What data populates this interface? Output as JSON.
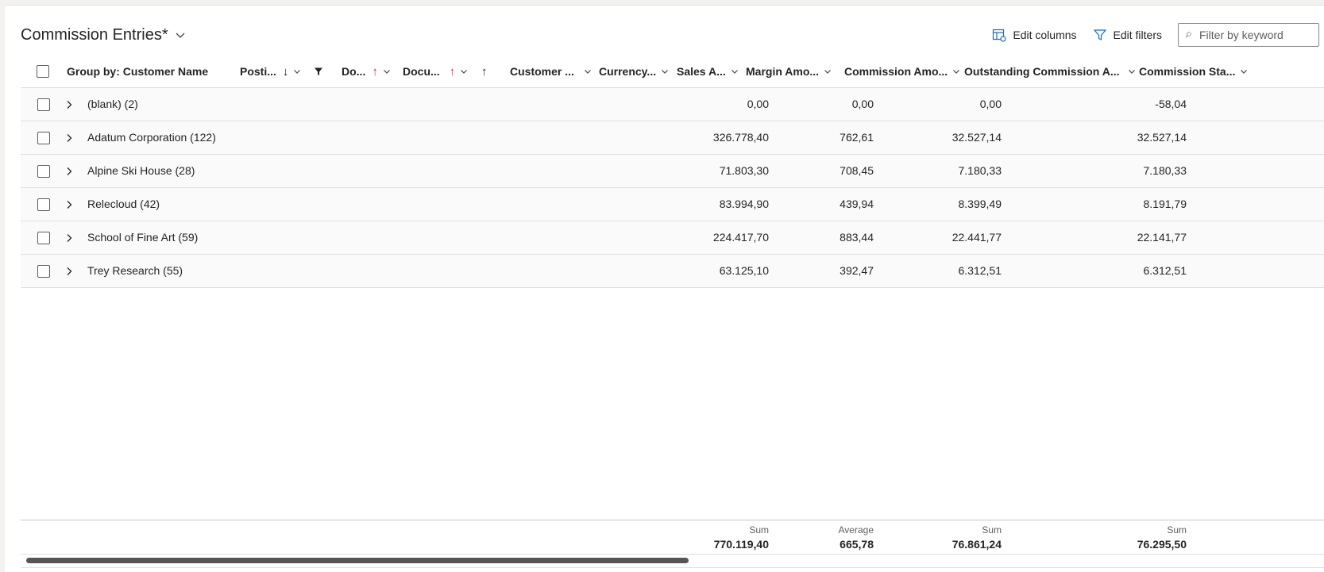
{
  "page": {
    "title": "Commission Entries*"
  },
  "toolbar": {
    "edit_columns": "Edit columns",
    "edit_filters": "Edit filters",
    "search_placeholder": "Filter by keyword"
  },
  "columns": {
    "group_by": "Group by: Customer Name",
    "posting": "Posti...",
    "doc_type": "Do...",
    "doc_no": "Docu...",
    "customer": "Customer ...",
    "currency": "Currency...",
    "sales": "Sales A...",
    "margin": "Margin Amo...",
    "commission": "Commission Amo...",
    "outstanding": "Outstanding Commission A...",
    "status": "Commission Sta..."
  },
  "groups": [
    {
      "name": "(blank) (2)",
      "sales": "0,00",
      "margin": "0,00",
      "commission": "0,00",
      "outstanding": "-58,04"
    },
    {
      "name": "Adatum Corporation (122)",
      "sales": "326.778,40",
      "margin": "762,61",
      "commission": "32.527,14",
      "outstanding": "32.527,14"
    },
    {
      "name": "Alpine Ski House (28)",
      "sales": "71.803,30",
      "margin": "708,45",
      "commission": "7.180,33",
      "outstanding": "7.180,33"
    },
    {
      "name": "Relecloud (42)",
      "sales": "83.994,90",
      "margin": "439,94",
      "commission": "8.399,49",
      "outstanding": "8.191,79"
    },
    {
      "name": "School of Fine Art (59)",
      "sales": "224.417,70",
      "margin": "883,44",
      "commission": "22.441,77",
      "outstanding": "22.141,77"
    },
    {
      "name": "Trey Research (55)",
      "sales": "63.125,10",
      "margin": "392,47",
      "commission": "6.312,51",
      "outstanding": "6.312,51"
    }
  ],
  "totals": {
    "sales": {
      "label": "Sum",
      "value": "770.119,40"
    },
    "margin": {
      "label": "Average",
      "value": "665,78"
    },
    "commission": {
      "label": "Sum",
      "value": "76.861,24"
    },
    "outstanding": {
      "label": "Sum",
      "value": "76.295,50"
    }
  },
  "colors": {
    "accent": "#0f6cbd",
    "sort_red": "#c4314b"
  }
}
